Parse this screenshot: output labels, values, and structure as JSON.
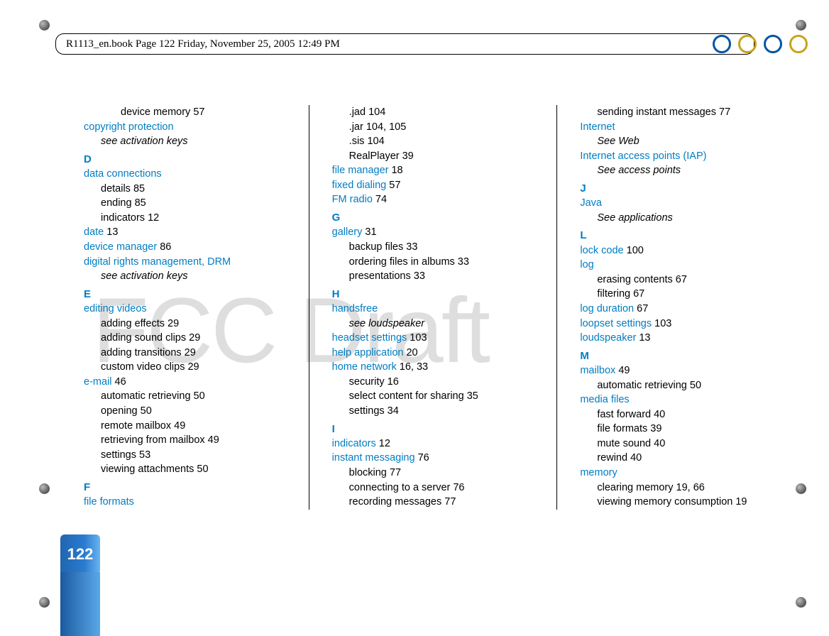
{
  "header": {
    "crop_text": "R1113_en.book  Page 122  Friday, November 25, 2005  12:49 PM"
  },
  "watermark": "FCC Draft",
  "page_number": "122",
  "col1": [
    {
      "type": "sub_extra",
      "text": "device memory 57"
    },
    {
      "type": "heading",
      "text": "copyright protection"
    },
    {
      "type": "sub_see",
      "prefix": "see ",
      "text": "activation keys"
    },
    {
      "type": "letter",
      "text": "D"
    },
    {
      "type": "heading",
      "text": "data connections"
    },
    {
      "type": "sub",
      "text": "details 85"
    },
    {
      "type": "sub",
      "text": "ending 85"
    },
    {
      "type": "sub",
      "text": "indicators 12"
    },
    {
      "type": "heading_inline",
      "text": "date",
      "after": " 13"
    },
    {
      "type": "heading_inline",
      "text": "device manager",
      "after": " 86"
    },
    {
      "type": "heading",
      "text": "digital rights management, DRM"
    },
    {
      "type": "sub_see",
      "prefix": "see ",
      "text": "activation keys"
    },
    {
      "type": "letter",
      "text": "E"
    },
    {
      "type": "heading",
      "text": "editing videos"
    },
    {
      "type": "sub",
      "text": "adding effects 29"
    },
    {
      "type": "sub",
      "text": "adding sound clips 29"
    },
    {
      "type": "sub",
      "text": "adding transitions 29"
    },
    {
      "type": "sub",
      "text": "custom video clips 29"
    },
    {
      "type": "heading_inline",
      "text": "e-mail",
      "after": " 46"
    },
    {
      "type": "sub",
      "text": "automatic retrieving 50"
    },
    {
      "type": "sub",
      "text": "opening 50"
    },
    {
      "type": "sub",
      "text": "remote mailbox 49"
    },
    {
      "type": "sub",
      "text": "retrieving from mailbox 49"
    },
    {
      "type": "sub",
      "text": "settings 53"
    },
    {
      "type": "sub",
      "text": "viewing attachments 50"
    },
    {
      "type": "letter",
      "text": "F"
    },
    {
      "type": "heading",
      "text": "file formats"
    }
  ],
  "col2": [
    {
      "type": "sub",
      "text": ".jad 104"
    },
    {
      "type": "sub",
      "text": ".jar 104, 105"
    },
    {
      "type": "sub",
      "text": ".sis 104"
    },
    {
      "type": "sub",
      "text": "RealPlayer 39"
    },
    {
      "type": "heading_inline",
      "text": "file manager",
      "after": " 18"
    },
    {
      "type": "heading_inline",
      "text": "fixed dialing",
      "after": " 57"
    },
    {
      "type": "heading_inline",
      "text": "FM radio",
      "after": " 74"
    },
    {
      "type": "letter",
      "text": "G"
    },
    {
      "type": "heading_inline",
      "text": "gallery",
      "after": " 31"
    },
    {
      "type": "sub",
      "text": "backup files 33"
    },
    {
      "type": "sub",
      "text": "ordering files in albums 33"
    },
    {
      "type": "sub",
      "text": "presentations 33"
    },
    {
      "type": "letter",
      "text": "H"
    },
    {
      "type": "heading",
      "text": "handsfree"
    },
    {
      "type": "sub_see",
      "prefix": "see ",
      "text": "loudspeaker"
    },
    {
      "type": "heading_inline",
      "text": "headset settings",
      "after": " 103"
    },
    {
      "type": "heading_inline",
      "text": "help application",
      "after": " 20"
    },
    {
      "type": "heading_inline",
      "text": "home network",
      "after": " 16, 33"
    },
    {
      "type": "sub",
      "text": "security 16"
    },
    {
      "type": "sub",
      "text": "select content for sharing 35"
    },
    {
      "type": "sub",
      "text": "settings 34"
    },
    {
      "type": "letter",
      "text": "I"
    },
    {
      "type": "heading_inline",
      "text": "indicators",
      "after": " 12"
    },
    {
      "type": "heading_inline",
      "text": "instant messaging",
      "after": " 76"
    },
    {
      "type": "sub",
      "text": "blocking 77"
    },
    {
      "type": "sub",
      "text": "connecting to a server 76"
    },
    {
      "type": "sub",
      "text": "recording messages 77"
    }
  ],
  "col3": [
    {
      "type": "sub",
      "text": "sending instant messages 77"
    },
    {
      "type": "heading",
      "text": "Internet"
    },
    {
      "type": "sub_see",
      "prefix": "See ",
      "text": "Web"
    },
    {
      "type": "heading",
      "text": "Internet access points (IAP)"
    },
    {
      "type": "sub_see",
      "prefix": "See ",
      "text": "access points"
    },
    {
      "type": "letter",
      "text": "J"
    },
    {
      "type": "heading",
      "text": "Java"
    },
    {
      "type": "sub_see",
      "prefix": "See ",
      "text": "applications"
    },
    {
      "type": "letter",
      "text": "L"
    },
    {
      "type": "heading_inline",
      "text": "lock code",
      "after": " 100"
    },
    {
      "type": "heading",
      "text": "log"
    },
    {
      "type": "sub",
      "text": "erasing contents 67"
    },
    {
      "type": "sub",
      "text": "filtering 67"
    },
    {
      "type": "heading_inline",
      "text": "log duration",
      "after": " 67"
    },
    {
      "type": "heading_inline",
      "text": "loopset settings",
      "after": " 103"
    },
    {
      "type": "heading_inline",
      "text": "loudspeaker",
      "after": " 13"
    },
    {
      "type": "letter",
      "text": "M"
    },
    {
      "type": "heading_inline",
      "text": "mailbox",
      "after": " 49"
    },
    {
      "type": "sub",
      "text": "automatic retrieving 50"
    },
    {
      "type": "heading",
      "text": "media files"
    },
    {
      "type": "sub",
      "text": "fast forward 40"
    },
    {
      "type": "sub",
      "text": "file formats 39"
    },
    {
      "type": "sub",
      "text": "mute sound 40"
    },
    {
      "type": "sub",
      "text": "rewind 40"
    },
    {
      "type": "heading",
      "text": "memory"
    },
    {
      "type": "sub",
      "text": "clearing memory 19, 66"
    },
    {
      "type": "sub",
      "text": "viewing memory consumption 19"
    }
  ]
}
